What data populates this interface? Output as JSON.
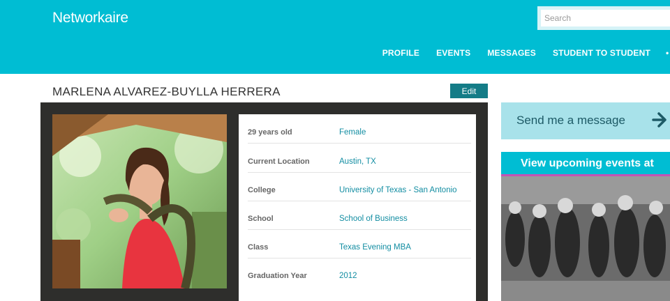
{
  "header": {
    "logo": "Networkaire",
    "search_placeholder": "Search",
    "nav": [
      "PROFILE",
      "EVENTS",
      "MESSAGES",
      "STUDENT TO STUDENT"
    ]
  },
  "profile": {
    "name": "MARLENA ALVAREZ-BUYLLA HERRERA",
    "edit_label": "Edit",
    "details": [
      {
        "label": "29 years old",
        "value": "Female"
      },
      {
        "label": "Current Location",
        "value": "Austin, TX"
      },
      {
        "label": "College",
        "value": "University of Texas - San Antonio"
      },
      {
        "label": "School",
        "value": "School of Business"
      },
      {
        "label": "Class",
        "value": "Texas Evening MBA"
      },
      {
        "label": "Graduation Year",
        "value": "2012"
      }
    ]
  },
  "sidebar": {
    "send_message": "Send me a message",
    "events_banner": "View upcoming events at"
  },
  "colors": {
    "brand": "#00bdd3",
    "edit_button": "#147c87",
    "link": "#128da2",
    "send_bg": "#a8e2ea",
    "banner_underline": "#c552b5"
  }
}
